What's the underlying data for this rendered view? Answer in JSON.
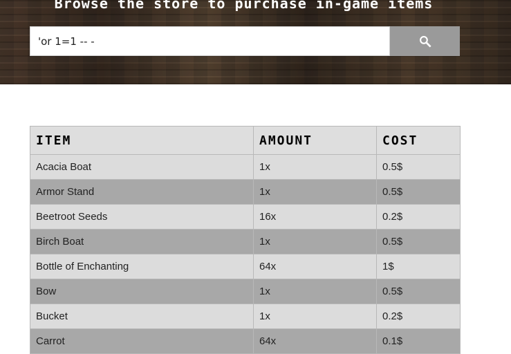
{
  "banner": {
    "title": "Browse the store to purchase in-game items"
  },
  "search": {
    "value": "'or 1=1 -- -",
    "button_icon": "search-icon"
  },
  "table": {
    "headers": [
      "ITEM",
      "AMOUNT",
      "COST"
    ],
    "rows": [
      [
        "Acacia Boat",
        "1x",
        "0.5$"
      ],
      [
        "Armor Stand",
        "1x",
        "0.5$"
      ],
      [
        "Beetroot Seeds",
        "16x",
        "0.2$"
      ],
      [
        "Birch Boat",
        "1x",
        "0.5$"
      ],
      [
        "Bottle of Enchanting",
        "64x",
        "1$"
      ],
      [
        "Bow",
        "1x",
        "0.5$"
      ],
      [
        "Bucket",
        "1x",
        "0.2$"
      ],
      [
        "Carrot",
        "64x",
        "0.1$"
      ]
    ]
  },
  "colors": {
    "row_light": "#dcdcdc",
    "row_dark": "#a8a8a8",
    "header_bg": "#dedede",
    "search_button": "#9a9a9a"
  }
}
